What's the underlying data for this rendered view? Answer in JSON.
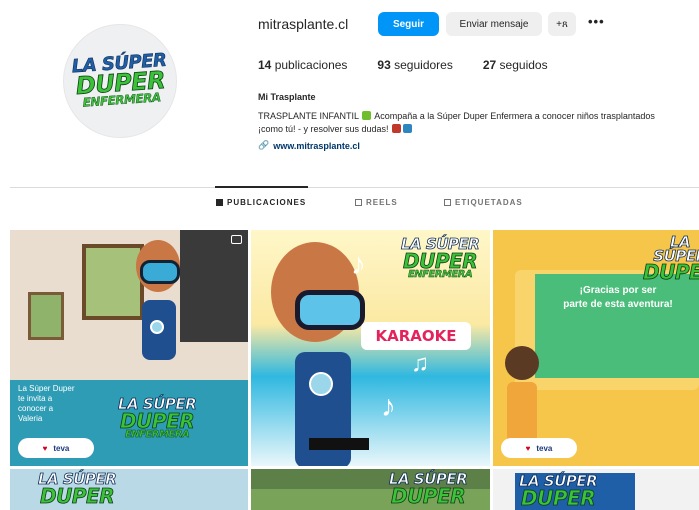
{
  "profile": {
    "avatar_logo": [
      "LA SÚPER",
      "DUPER",
      "ENFERMERA"
    ],
    "username": "mitrasplante.cl",
    "follow_label": "Seguir",
    "message_label": "Enviar mensaje",
    "suggest_label": "+ጸ",
    "more_label": "•••",
    "stats": {
      "posts_count": "14",
      "posts_label": "publicaciones",
      "followers_count": "93",
      "followers_label": "seguidores",
      "following_count": "27",
      "following_label": "seguidos"
    },
    "full_name": "Mi Trasplante",
    "bio_line1": "TRASPLANTE INFANTIL ",
    "bio_line1b": " Acompaña a la Súper Duper Enfermera a conocer niños trasplantados",
    "bio_line2": "¡como tú! - y resolver sus dudas! ",
    "link_icon": "🔗",
    "link": "www.mitrasplante.cl"
  },
  "tabs": [
    {
      "label": "PUBLICACIONES",
      "icon": "grid-icon",
      "active": true
    },
    {
      "label": "REELS",
      "icon": "reels-icon",
      "active": false
    },
    {
      "label": "ETIQUETADAS",
      "icon": "tagged-icon",
      "active": false
    }
  ],
  "posts": {
    "p1_logo": [
      "LA SÚPER",
      "DUPER",
      "ENFERMERA"
    ],
    "p1_caption": [
      "La Súper Duper",
      "te invita a",
      "conocer a",
      "Valeria"
    ],
    "p1_pill": "teva",
    "p2_logo": [
      "LA SÚPER",
      "DUPER",
      "ENFERMERA"
    ],
    "p2_karaoke": "KARAOKE",
    "p3_logo": [
      "LA SÚPER",
      "DUPER"
    ],
    "p3_thanks": [
      "¡Gracias por ser",
      "parte de esta aventura!"
    ],
    "p3_pill": "teva",
    "p4_logo": [
      "LA SÚPER",
      "DUPER"
    ],
    "p5_logo": [
      "LA SÚPER",
      "DUPER"
    ],
    "p6_logo": [
      "LA SÚPER",
      "DUPER"
    ]
  },
  "colors": {
    "accent": "#0095f6",
    "logo_blue": "#1f5fa8",
    "logo_green": "#3cc13a",
    "karaoke_red": "#e3245c"
  }
}
